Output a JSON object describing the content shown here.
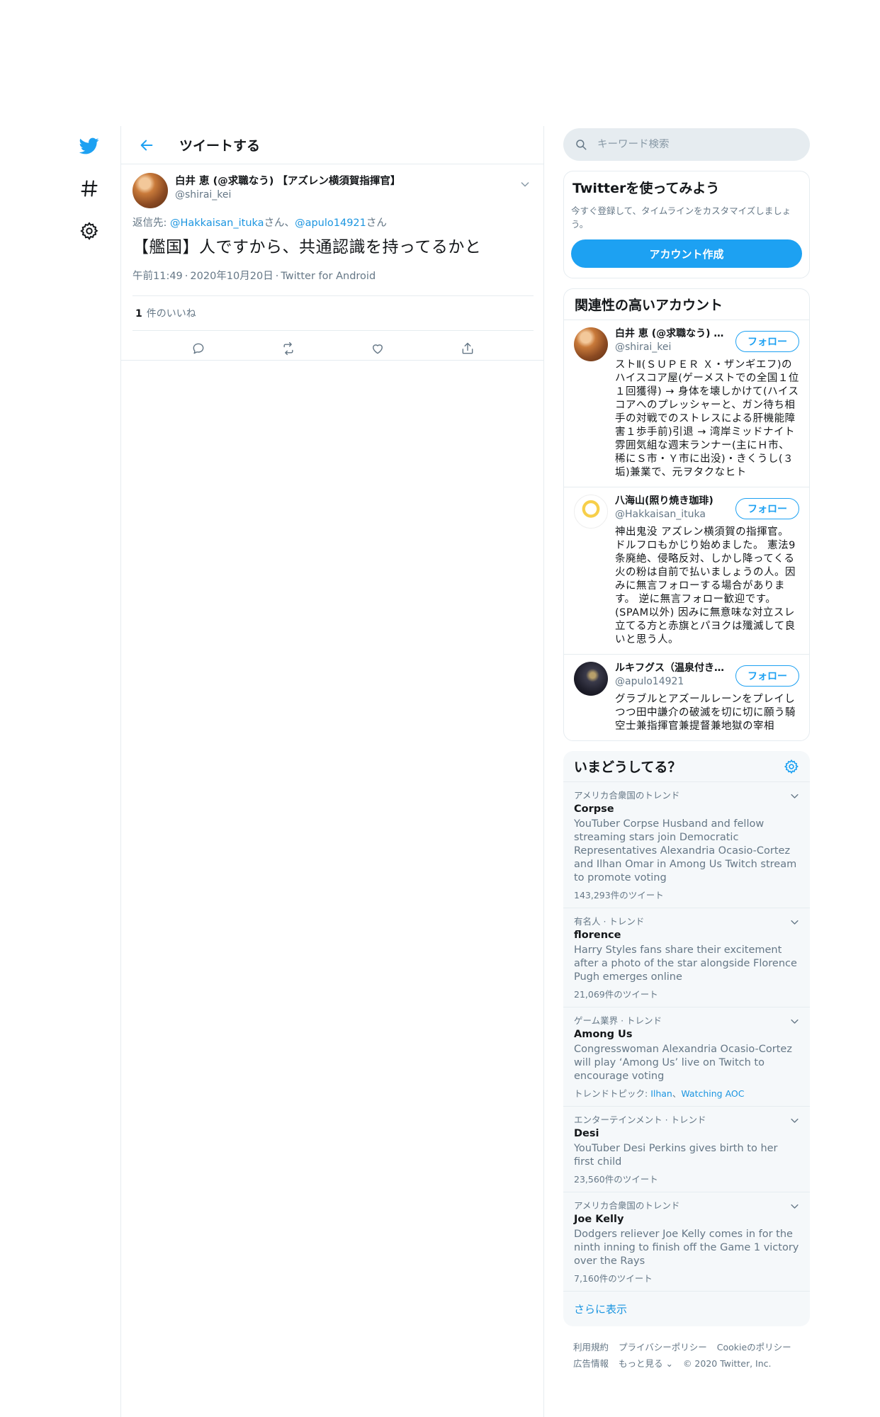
{
  "nav": {
    "items": [
      "twitter-logo",
      "explore-hashtag",
      "settings-gear"
    ]
  },
  "header": {
    "title": "ツイートする"
  },
  "tweet": {
    "name": "白井 恵 (@求職なう) 【アズレン横須賀指揮官】",
    "handle": "@shirai_kei",
    "replying_prefix": "返信先: ",
    "reply_to_1": "@Hakkaisan_ituka",
    "reply_suffix_1": "さん、",
    "reply_to_2": "@apulo14921",
    "reply_suffix_2": "さん",
    "text": "【艦国】人ですから、共通認識を持ってるかと",
    "time": "午前11:49",
    "date": "2020年10月20日",
    "source": "Twitter for Android",
    "meta_sep": "·",
    "likes_count": "1",
    "likes_label": "件のいいね"
  },
  "search": {
    "placeholder": "キーワード検索"
  },
  "signup": {
    "title": "Twitterを使ってみよう",
    "description": "今すぐ登録して、タイムラインをカスタマイズしましょう。",
    "button": "アカウント作成"
  },
  "related": {
    "title": "関連性の高いアカウント",
    "follow_label": "フォロー",
    "accounts": [
      {
        "name": "白井 恵 (@求職なう) 【アズレン横須賀指揮官】",
        "handle": "@shirai_kei",
        "bio": "ストⅡ(ＳＵＰＥＲ Ｘ・ザンギエフ)のハイスコア屋(ゲーメストでの全国１位１回獲得) → 身体を壊しかけて(ハイスコアへのプレッシャーと、ガン待ち相手の対戦でのストレスによる肝機能障害１歩手前)引退 → 湾岸ミッドナイト雰囲気組な週末ランナー(主にＨ市、稀にＳ市・Ｙ市に出没)・きくうし(３垢)兼業で、元ヲタクなヒト"
      },
      {
        "name": "八海山(照り焼き珈琲)",
        "handle": "@Hakkaisan_ituka",
        "bio": "神出鬼没 アズレン横須賀の指揮官。ドルフロもかじり始めました。 憲法9条廃絶、侵略反対、しかし降ってくる火の粉は自前で払いましょうの人。因みに無言フォローする場合があります。 逆に無言フォロー歓迎です。(SPAM以外) 因みに無意味な対立スレ立てる方と赤旗とパヨクは殲滅して良いと思う人。"
      },
      {
        "name": "ルキフグス（温泉付き雪原）",
        "handle": "@apulo14921",
        "bio": "グラブルとアズールレーンをプレイしつつ田中謙介の破滅を切に切に願う騎空士兼指揮官兼提督兼地獄の宰相"
      }
    ]
  },
  "trends": {
    "title": "いまどうしてる？",
    "items": [
      {
        "context": "アメリカ合衆国のトレンド",
        "name": "Corpse",
        "description": "YouTuber Corpse Husband and fellow streaming stars join Democratic Representatives Alexandria Ocasio-Cortez and Ilhan Omar in Among Us Twitch stream to promote voting",
        "count": "143,293件のツイート"
      },
      {
        "context": "有名人 · トレンド",
        "name": "florence",
        "description": "Harry Styles fans share their excitement after a photo of the star alongside Florence Pugh emerges online",
        "count": "21,069件のツイート"
      },
      {
        "context": "ゲーム業界 · トレンド",
        "name": "Among Us",
        "description": "Congresswoman Alexandria Ocasio-Cortez will play ‘Among Us’ live on Twitch to encourage voting",
        "topics_label": "トレンドトピック: ",
        "topic_1": "Ilhan",
        "topic_sep": "、",
        "topic_2": "Watching AOC"
      },
      {
        "context": "エンターテインメント · トレンド",
        "name": "Desi",
        "description": "YouTuber Desi Perkins gives birth to her first child",
        "count": "23,560件のツイート"
      },
      {
        "context": "アメリカ合衆国のトレンド",
        "name": "Joe Kelly",
        "description": "Dodgers reliever Joe Kelly comes in for the ninth inning to finish off the Game 1 victory over the Rays",
        "count": "7,160件のツイート"
      }
    ],
    "show_more": "さらに表示"
  },
  "footer": {
    "terms": "利用規約",
    "privacy": "プライバシーポリシー",
    "cookie": "Cookieのポリシー",
    "ads": "広告情報",
    "more": "もっと見る ⌄",
    "copyright": "© 2020 Twitter, Inc."
  },
  "colors": {
    "accent": "#1da1f2",
    "link": "#1b95e0",
    "secondary_text": "#657786",
    "border": "#e6ecf0",
    "trend_bg": "#f5f8fa"
  }
}
